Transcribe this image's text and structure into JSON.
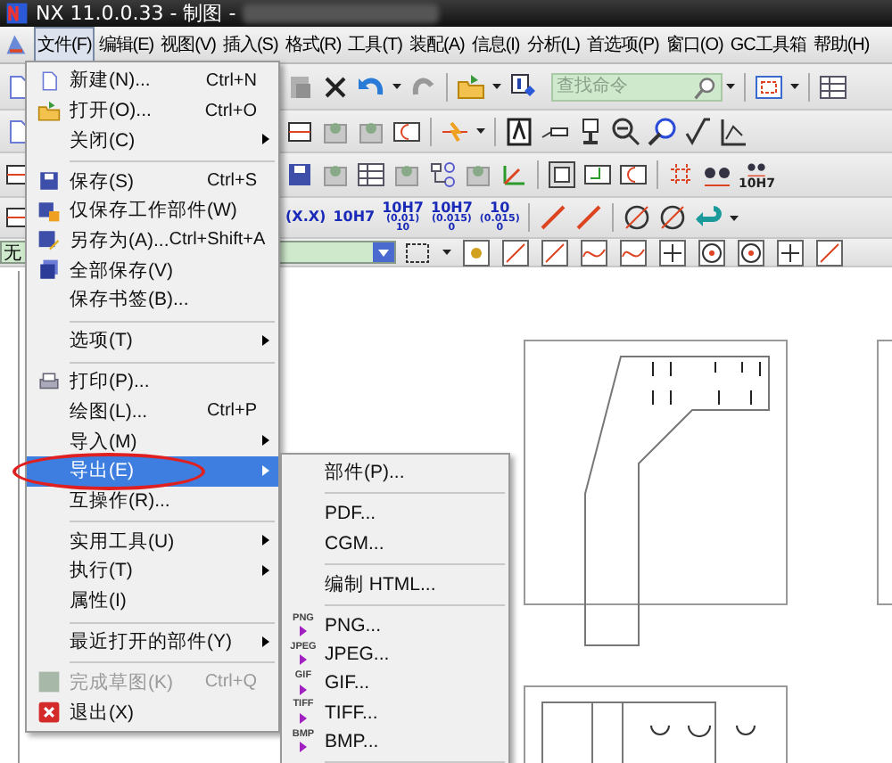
{
  "window": {
    "title": "NX 11.0.0.33 - 制图 -",
    "redacted": true
  },
  "menubar": [
    {
      "label": "文件(F)",
      "selected": true
    },
    {
      "label": "编辑(E)",
      "selected": false
    },
    {
      "label": "视图(V)",
      "selected": false
    },
    {
      "label": "插入(S)",
      "selected": false
    },
    {
      "label": "格式(R)",
      "selected": false
    },
    {
      "label": "工具(T)",
      "selected": false
    },
    {
      "label": "装配(A)",
      "selected": false
    },
    {
      "label": "信息(I)",
      "selected": false
    },
    {
      "label": "分析(L)",
      "selected": false
    },
    {
      "label": "首选项(P)",
      "selected": false
    },
    {
      "label": "窗口(O)",
      "selected": false
    },
    {
      "label": "GC工具箱",
      "selected": false
    },
    {
      "label": "帮助(H)",
      "selected": false
    }
  ],
  "toolbar": {
    "search": {
      "placeholder": "查找命令"
    },
    "dimension_buttons": [
      {
        "lines": [
          "(X.X)"
        ]
      },
      {
        "lines": [
          "10H7"
        ]
      },
      {
        "lines": [
          "10H7",
          "(0.01)",
          "10"
        ]
      },
      {
        "lines": [
          "10H7",
          "(0.015)",
          "0"
        ]
      },
      {
        "lines": [
          "10",
          "(0.015)",
          "0"
        ]
      }
    ],
    "tolerance_label": "10H7",
    "filter": {
      "value": "无"
    }
  },
  "file_menu": {
    "items": [
      {
        "kind": "item",
        "label": "新建(N)...",
        "shortcut": "Ctrl+N",
        "submenu": false,
        "selected": false,
        "disabled": false
      },
      {
        "kind": "item",
        "label": "打开(O)...",
        "shortcut": "Ctrl+O",
        "submenu": false,
        "selected": false,
        "disabled": false
      },
      {
        "kind": "item",
        "label": "关闭(C)",
        "submenu": true,
        "selected": false,
        "disabled": false
      },
      {
        "kind": "separator"
      },
      {
        "kind": "item",
        "label": "保存(S)",
        "shortcut": "Ctrl+S",
        "submenu": false,
        "selected": false,
        "disabled": false
      },
      {
        "kind": "item",
        "label": "仅保存工作部件(W)",
        "submenu": false,
        "selected": false,
        "disabled": false
      },
      {
        "kind": "item",
        "label": "另存为(A)...",
        "shortcut": "Ctrl+Shift+A",
        "submenu": false,
        "selected": false,
        "disabled": false
      },
      {
        "kind": "item",
        "label": "全部保存(V)",
        "submenu": false,
        "selected": false,
        "disabled": false
      },
      {
        "kind": "item",
        "label": "保存书签(B)...",
        "submenu": false,
        "selected": false,
        "disabled": false
      },
      {
        "kind": "separator"
      },
      {
        "kind": "item",
        "label": "选项(T)",
        "submenu": true,
        "selected": false,
        "disabled": false
      },
      {
        "kind": "separator"
      },
      {
        "kind": "item",
        "label": "打印(P)...",
        "submenu": false,
        "selected": false,
        "disabled": false
      },
      {
        "kind": "item",
        "label": "绘图(L)...",
        "shortcut": "Ctrl+P",
        "submenu": false,
        "selected": false,
        "disabled": false
      },
      {
        "kind": "item",
        "label": "导入(M)",
        "submenu": true,
        "selected": false,
        "disabled": false
      },
      {
        "kind": "item",
        "label": "导出(E)",
        "submenu": true,
        "selected": true,
        "disabled": false,
        "circled": true
      },
      {
        "kind": "item",
        "label": "互操作(R)...",
        "submenu": false,
        "selected": false,
        "disabled": false
      },
      {
        "kind": "separator"
      },
      {
        "kind": "item",
        "label": "实用工具(U)",
        "submenu": true,
        "selected": false,
        "disabled": false
      },
      {
        "kind": "item",
        "label": "执行(T)",
        "submenu": true,
        "selected": false,
        "disabled": false
      },
      {
        "kind": "item",
        "label": "属性(I)",
        "submenu": false,
        "selected": false,
        "disabled": false
      },
      {
        "kind": "separator"
      },
      {
        "kind": "item",
        "label": "最近打开的部件(Y)",
        "submenu": true,
        "selected": false,
        "disabled": false
      },
      {
        "kind": "separator"
      },
      {
        "kind": "item",
        "label": "完成草图(K)",
        "shortcut": "Ctrl+Q",
        "submenu": false,
        "selected": false,
        "disabled": true
      },
      {
        "kind": "item",
        "label": "退出(X)",
        "submenu": false,
        "selected": false,
        "disabled": false
      }
    ]
  },
  "export_submenu": {
    "items": [
      {
        "kind": "item",
        "label": "部件(P)..."
      },
      {
        "kind": "separator"
      },
      {
        "kind": "item",
        "label": "PDF..."
      },
      {
        "kind": "item",
        "label": "CGM..."
      },
      {
        "kind": "separator"
      },
      {
        "kind": "item",
        "label": "编制 HTML..."
      },
      {
        "kind": "separator"
      },
      {
        "kind": "item",
        "label": "PNG...",
        "badge": "PNG"
      },
      {
        "kind": "item",
        "label": "JPEG...",
        "badge": "JPEG"
      },
      {
        "kind": "item",
        "label": "GIF...",
        "badge": "GIF"
      },
      {
        "kind": "item",
        "label": "TIFF...",
        "badge": "TIFF"
      },
      {
        "kind": "item",
        "label": "BMP...",
        "badge": "BMP"
      },
      {
        "kind": "separator"
      }
    ]
  }
}
